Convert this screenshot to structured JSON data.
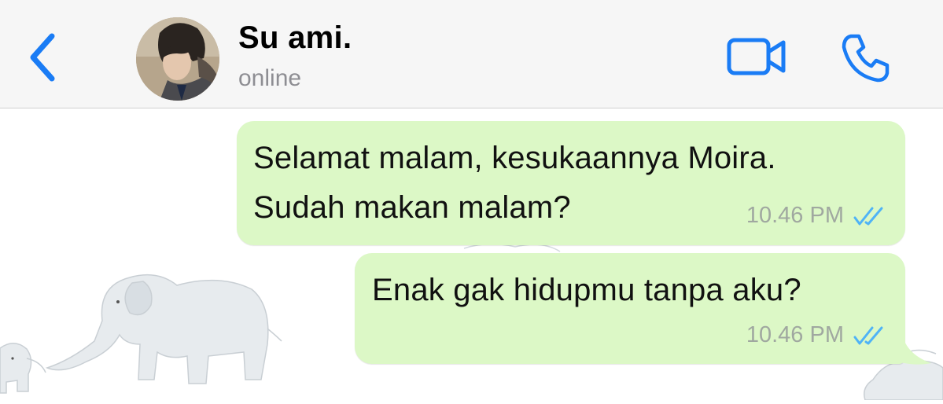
{
  "header": {
    "contact_name": "Su ami.",
    "status": "online"
  },
  "icons": {
    "back": "chevron-left-icon",
    "video": "video-camera-icon",
    "call": "phone-icon",
    "read_receipt": "double-check-icon"
  },
  "colors": {
    "accent": "#1a7cf5",
    "outgoing_bubble": "#dcf8c6",
    "header_bg": "#f6f6f6",
    "read_tick": "#4fb3f6",
    "timestamp": "#a0a8a0"
  },
  "messages": [
    {
      "text": "Selamat malam, kesukaannya Moira.\nSudah makan malam?",
      "time": "10.46 PM",
      "status": "read"
    },
    {
      "text": "Enak gak hidupmu tanpa aku?",
      "time": "10.46 PM",
      "status": "read"
    }
  ]
}
